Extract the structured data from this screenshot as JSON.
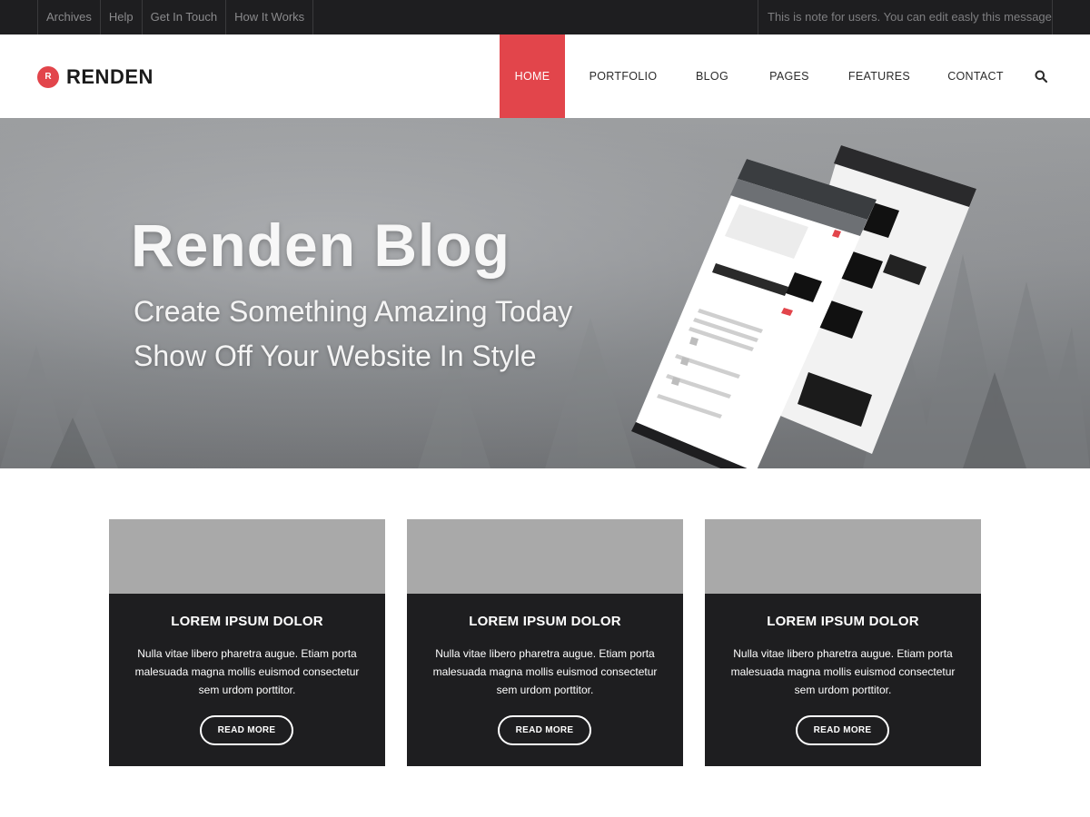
{
  "topbar": {
    "links": [
      "Archives",
      "Help",
      "Get In Touch",
      "How It Works"
    ],
    "note": "This is note for users. You can edit easly this message."
  },
  "header": {
    "logo_badge": "R",
    "logo_text": "RENDEN",
    "nav": [
      "HOME",
      "PORTFOLIO",
      "BLOG",
      "PAGES",
      "FEATURES",
      "CONTACT"
    ],
    "active_nav": "HOME",
    "search_icon": "search-icon"
  },
  "hero": {
    "title": "Renden Blog",
    "subtitle_line1": "Create Something Amazing Today",
    "subtitle_line2": "Show Off Your Website In Style"
  },
  "cards": [
    {
      "title": "LOREM IPSUM DOLOR",
      "text": "Nulla vitae libero pharetra augue. Etiam porta malesuada magna mollis euismod consectetur sem urdom porttitor.",
      "button": "READ MORE"
    },
    {
      "title": "LOREM IPSUM DOLOR",
      "text": "Nulla vitae libero pharetra augue. Etiam porta malesuada magna mollis euismod consectetur sem urdom porttitor.",
      "button": "READ MORE"
    },
    {
      "title": "LOREM IPSUM DOLOR",
      "text": "Nulla vitae libero pharetra augue. Etiam porta malesuada magna mollis euismod consectetur sem urdom porttitor.",
      "button": "READ MORE"
    }
  ],
  "colors": {
    "accent": "#e2454b",
    "topbar_bg": "#1e1e20",
    "card_body_bg": "#1e1e20",
    "card_thumb_bg": "#a9a9a9"
  }
}
